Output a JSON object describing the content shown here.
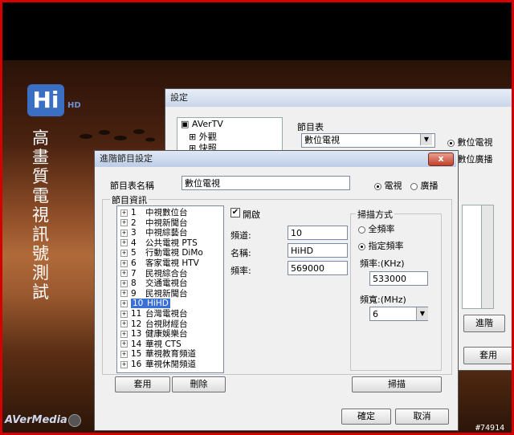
{
  "video": {
    "vertical_title": "高畫質電視訊號測試",
    "logo_text": "Hi",
    "logo_sub": "HD",
    "brand": "AVerMedia",
    "watermark": "#74914"
  },
  "back_window": {
    "title": "設定",
    "tree": [
      "AVerTV",
      "外觀",
      "快照"
    ],
    "program_table_label": "節目表",
    "program_table_value": "數位電視",
    "radio_digital": "數位電視",
    "radio_digital_radio": "數位廣播",
    "advanced_button": "進階",
    "apply_button": "套用"
  },
  "dialog": {
    "title": "進階節目設定",
    "close_label": "x",
    "name_label": "節目表名稱",
    "name_value": "數位電視",
    "radio_video": "電視",
    "radio_broadcast": "廣播",
    "group_label": "節目資訊",
    "channels": [
      {
        "num": "1",
        "name": "中視數位台"
      },
      {
        "num": "2",
        "name": "中視新聞台"
      },
      {
        "num": "3",
        "name": "中視綜藝台"
      },
      {
        "num": "4",
        "name": "公共電視 PTS"
      },
      {
        "num": "5",
        "name": "行動電視 DiMo"
      },
      {
        "num": "6",
        "name": "客家電視 HTV"
      },
      {
        "num": "7",
        "name": "民視綜合台"
      },
      {
        "num": "8",
        "name": "交通電視台"
      },
      {
        "num": "9",
        "name": "民視新聞台"
      },
      {
        "num": "10",
        "name": "HiHD"
      },
      {
        "num": "11",
        "name": "台灣電視台"
      },
      {
        "num": "12",
        "name": "台視財經台"
      },
      {
        "num": "13",
        "name": "健康娛樂台"
      },
      {
        "num": "14",
        "name": "華視 CTS"
      },
      {
        "num": "15",
        "name": "華視教育頻道"
      },
      {
        "num": "16",
        "name": "華視休閒頻道"
      }
    ],
    "enable_label": "開啟",
    "enable_checked": "✔",
    "channel_label": "頻道:",
    "channel_value": "10",
    "name_field_label": "名稱:",
    "name_field_value": "HiHD",
    "freq_label": "頻率:",
    "freq_value": "569000",
    "scan_group_label": "掃描方式",
    "scan_all": "全頻率",
    "scan_specified": "指定頻率",
    "scan_freq_label": "頻率:(KHz)",
    "scan_freq_value": "533000",
    "bandwidth_label": "頻寬:(MHz)",
    "bandwidth_value": "6",
    "apply_button": "套用",
    "delete_button": "刪除",
    "scan_button": "掃描",
    "ok_button": "確定",
    "cancel_button": "取消"
  }
}
